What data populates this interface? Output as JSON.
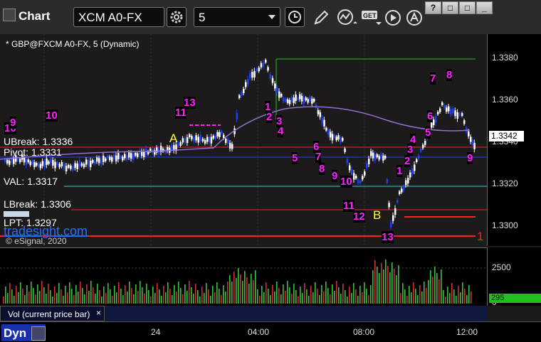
{
  "window": {
    "title": "Chart",
    "symbol": "XCM A0-FX",
    "interval": "5",
    "controls": [
      "?",
      "□",
      "□",
      "_"
    ]
  },
  "chart": {
    "study_title": "* GBP@FXCM A0-FX, 5 (Dynamic)",
    "copyright": "© eSignal, 2020",
    "watermark": "tradesight.com",
    "levels": {
      "ubreak": "UBreak: 1.3336",
      "pivot": "Pivot: 1.3331",
      "val": "VAL: 1.3317",
      "lbreak": "LBreak: 1.3306",
      "lpt": "LPT: 1.3297"
    },
    "markers": {
      "a": "A",
      "b": "B",
      "one": "1"
    },
    "price_ticks": [
      "1.3380",
      "1.3360",
      "1.3340",
      "1.3320",
      "1.3300"
    ],
    "current_price": "1.3342",
    "volume": {
      "label": "Vol (current price bar)",
      "ticks": [
        "2500",
        "0"
      ],
      "current": "295",
      "close_icon": "×"
    },
    "time_ticks": [
      "24",
      "04:00",
      "08:00",
      "12:00"
    ],
    "dyn_label": "Dyn"
  },
  "seq_labels": [
    "10",
    "9",
    "10",
    "11",
    "13",
    "1",
    "2",
    "3",
    "4",
    "5",
    "6",
    "7",
    "8",
    "9",
    "10",
    "11",
    "12",
    "13",
    "1",
    "2",
    "3",
    "4",
    "5",
    "6",
    "7",
    "8",
    "9"
  ],
  "colors": {
    "bg": "#1c1a1a",
    "up": "#ffffff",
    "down": "#1f3fff",
    "seq": "#ff22ff",
    "red_line": "#ff2020",
    "green_line": "#20c020",
    "vwap": "#9070d0",
    "vol_up": "#3cc03c",
    "vol_down": "#d03030"
  }
}
